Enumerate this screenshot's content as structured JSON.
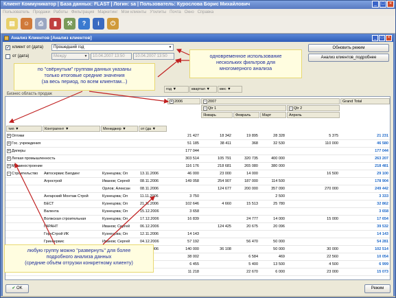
{
  "window": {
    "title": "Клиент Коммуникатор | База данных: FLAST | Логин: sa | Пользователь: Курослова Борис Михайлович"
  },
  "menu": [
    "Пользователь",
    "Продажи",
    "Работы",
    "Фильтрация",
    "Маркетинг",
    "Мои клиенты",
    "Утилиты",
    "Почта",
    "Окно",
    "Справка"
  ],
  "toolbar_icons": [
    "doc-icon",
    "people-icon",
    "print-icon",
    "chart-icon",
    "tools-icon",
    "help-icon",
    "info-icon",
    "exit-icon"
  ],
  "child": {
    "title": "Анализ Клиентов [Анализ клиентов]"
  },
  "filters": {
    "client_label": "клиент от (дата)",
    "client_value": "Прошедший год",
    "from_label": "от (дата)",
    "from_type": "Между",
    "date1": "10.04.2007 13:50",
    "date2": "10.04.2007 13:50",
    "update_btn": "Обновить режим",
    "analysis_btn": "Анализ клиентов_подробнее"
  },
  "pivot": {
    "drop_area": "Бизнес область продаж",
    "column_fields": [
      "год",
      "квартал",
      "мес"
    ],
    "row_fields": [
      "тип",
      "Контрагент",
      "Менеджер",
      "от (да"
    ],
    "year_2006": "2006",
    "year_2007": "2007",
    "qtr1": "Qtr 1",
    "qtr2": "Qtr 2",
    "months": [
      "Январь",
      "Февраль",
      "Март",
      "Апрель"
    ],
    "grand_total": "Grand Total",
    "rows": [
      {
        "type": "Оптики",
        "client": "",
        "manager": "",
        "date": "",
        "v2006": "21 427",
        "m1": "18 342",
        "m2": "19 895",
        "m3": "28 328",
        "m4": "5 375",
        "gt": "21 231"
      },
      {
        "type": "Гос. учреждения",
        "client": "",
        "manager": "",
        "date": "",
        "v2006": "51 185",
        "m1": "38 411",
        "m2": "368",
        "m3": "32 530",
        "m4": "110 000",
        "gt": "46 580"
      },
      {
        "type": "Дилеры",
        "client": "",
        "manager": "",
        "date": "",
        "v2006": "177 044",
        "m1": "",
        "m2": "",
        "m3": "",
        "m4": "",
        "gt": "177 044"
      },
      {
        "type": "Легкая промышленность",
        "client": "",
        "manager": "",
        "date": "",
        "v2006": "303 514",
        "m1": "105 791",
        "m2": "320 735",
        "m3": "400 000",
        "m4": "",
        "gt": "263 207"
      },
      {
        "type": "Машиностроение",
        "client": "",
        "manager": "",
        "date": "",
        "v2006": "116 176",
        "m1": "218 681",
        "m2": "265 080",
        "m3": "380 000",
        "m4": "",
        "gt": "218 481"
      },
      {
        "type": "Строительство",
        "client": "Автосервис Билдинг",
        "manager": "Кузнецова; Ол",
        "date": "13.11.2006",
        "v2006": "46 000",
        "m1": "23 000",
        "m2": "14 000",
        "m3": "",
        "m4": "16 500",
        "gt": "29 100"
      },
      {
        "type": "",
        "client": "Агрострой",
        "manager": "Иванов; Сергей",
        "date": "08.11.2006",
        "v2006": "149 058",
        "m1": "254 907",
        "m2": "187 000",
        "m3": "114 500",
        "m4": "",
        "gt": "178 904"
      },
      {
        "type": "",
        "client": "",
        "manager": "Орлов; Алексан",
        "date": "08.11.2006",
        "v2006": "",
        "m1": "124 677",
        "m2": "200 000",
        "m3": "357 090",
        "m4": "270 000",
        "gt": "249 442"
      },
      {
        "type": "",
        "client": "Ангарский Монтаж Строй",
        "manager": "Кузнецова; Ол",
        "date": "11.11.2006",
        "v2006": "3 750",
        "m1": "",
        "m2": "",
        "m3": "2 500",
        "m4": "",
        "gt": "3 333"
      },
      {
        "type": "",
        "client": "БЕСТ",
        "manager": "Кузнецова; Ол",
        "date": "21.11.2006",
        "v2006": "102 646",
        "m1": "4 660",
        "m2": "15 513",
        "m3": "25 780",
        "m4": "",
        "gt": "32 862"
      },
      {
        "type": "",
        "client": "Валента",
        "manager": "Кузнецова; Ол",
        "date": "15.12.2006",
        "v2006": "3 658",
        "m1": "",
        "m2": "",
        "m3": "",
        "m4": "",
        "gt": "3 658"
      },
      {
        "type": "",
        "client": "Волжская строительная",
        "manager": "Кузнецова; Ол",
        "date": "17.12.2006",
        "v2006": "16 839",
        "m1": "",
        "m2": "24 777",
        "m3": "14 000",
        "m4": "15 000",
        "gt": "17 654"
      },
      {
        "type": "",
        "client": "ГАРАНТ",
        "manager": "Иванов; Сергей",
        "date": "06.12.2006",
        "v2006": "",
        "m1": "124 425",
        "m2": "20 675",
        "m3": "20 096",
        "m4": "",
        "gt": "39 532"
      },
      {
        "type": "",
        "client": "ГорнСтрой ИК",
        "manager": "Кузнецова; Ол",
        "date": "12.11.2006",
        "v2006": "14 143",
        "m1": "",
        "m2": "",
        "m3": "",
        "m4": "",
        "gt": "14 143"
      },
      {
        "type": "",
        "client": "Гринсервис",
        "manager": "Иванов; Сергей",
        "date": "04.12.2006",
        "v2006": "57 192",
        "m1": "",
        "m2": "56 470",
        "m3": "50 000",
        "m4": "",
        "gt": "54 281"
      },
      {
        "type": "",
        "client": "ИнвТехноСтрой",
        "manager": "Кузнецова; Ол",
        "date": "07.11.2006",
        "v2006": "140 000",
        "m1": "36 108",
        "m2": "",
        "m3": "50 000",
        "m4": "30 000",
        "gt": "102 514"
      },
      {
        "type": "",
        "client": "",
        "manager": "",
        "date": "",
        "v2006": "38 002",
        "m1": "",
        "m2": "6 584",
        "m3": "469",
        "m4": "22 560",
        "gt": "10 054"
      },
      {
        "type": "",
        "client": "",
        "manager": "",
        "date": "",
        "v2006": "6 455",
        "m1": "",
        "m2": "5 400",
        "m3": "13 500",
        "m4": "4 500",
        "gt": "6 999"
      },
      {
        "type": "",
        "client": "",
        "manager": "",
        "date": "",
        "v2006": "11 218",
        "m1": "",
        "m2": "22 670",
        "m3": "6 000",
        "m4": "23 000",
        "gt": "15 073"
      }
    ]
  },
  "callouts": {
    "c1": "по \"свёрнутым\" группам данных указаны\nтолько итоговые средние значения\n(за весь период, по всем клиентам...)",
    "c2": "одновременное использование\nнескольких фильтров для\nмногомерного анализа",
    "c3": "любую группу можно \"развернуть\" для более\nподробного анализа данных\n(средние объём отгрузки конкретному клиенту)"
  },
  "bottom": {
    "ok": "OK",
    "mode": "Режим"
  }
}
